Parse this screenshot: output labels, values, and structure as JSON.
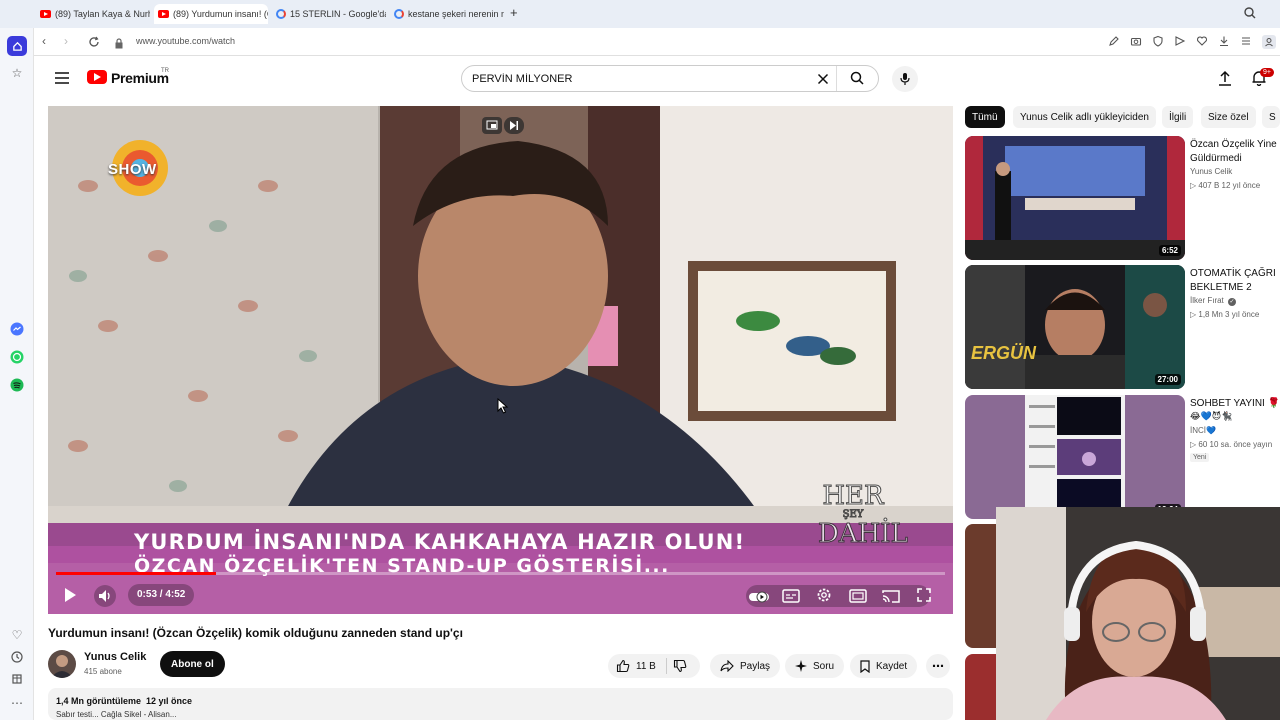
{
  "browser": {
    "tabs": [
      {
        "label": "(89) Taylan Kaya & Nurha"
      },
      {
        "label": "(89) Yurdumun insanı! (Öz"
      },
      {
        "label": "15 STERLIN - Google'da A"
      },
      {
        "label": "kestane şekeri nerenin me"
      }
    ],
    "new_tab": "+",
    "url": "www.youtube.com/watch"
  },
  "header": {
    "brand": "Premium",
    "region": "TR",
    "search_value": "PERVİN MİLYONER",
    "notif_count": "9+"
  },
  "player": {
    "channel_bug": "SHOW",
    "caption_line1": "YURDUM İNSANI'NDA KAHKAHAYA HAZIR OLUN!",
    "caption_line2": "ÖZCAN ÖZÇELİK'TEN STAND-UP GÖSTERİSİ...",
    "watermark": [
      "HER",
      "ŞEY",
      "DAHİL"
    ],
    "time": "0:53 / 4:52",
    "progress": 0.18
  },
  "video": {
    "title": "Yurdumun insanı! (Özcan Özçelik) komik olduğunu zanneden stand up'çı",
    "channel": "Yunus Celik",
    "subs": "415 abone",
    "subscribe": "Abone ol",
    "likes": "11 B",
    "share": "Paylaş",
    "ask": "Soru",
    "save": "Kaydet",
    "views": "1,4 Mn görüntüleme  12 yıl önce",
    "desc": "Sabır testi... Cağla Sikel - Alisan..."
  },
  "chips": [
    "Tümü",
    "Yunus Celik adlı yükleyiciden",
    "İlgili",
    "Size özel",
    "S"
  ],
  "recommendations": [
    {
      "title": "Özcan Özçelik Yine Güldürmedi",
      "channel": "Yunus Celik",
      "meta": "▷ 407 B  12 yıl önce",
      "duration": "6:52"
    },
    {
      "title": "OTOMATİK ÇAĞRI BEKLETME 2",
      "channel": "İlker Fırat",
      "meta": "▷ 1,8 Mn  3 yıl önce",
      "duration": "27:00"
    },
    {
      "title": "SOHBET YAYINI 🌹",
      "channel": "İNCİ💙",
      "meta": "▷ 60  10 sa. önce yayın",
      "badge": "Yeni",
      "duration": "12:24"
    }
  ],
  "colors": {
    "accent": "#ff0000",
    "caption_band": "#a8489a"
  }
}
